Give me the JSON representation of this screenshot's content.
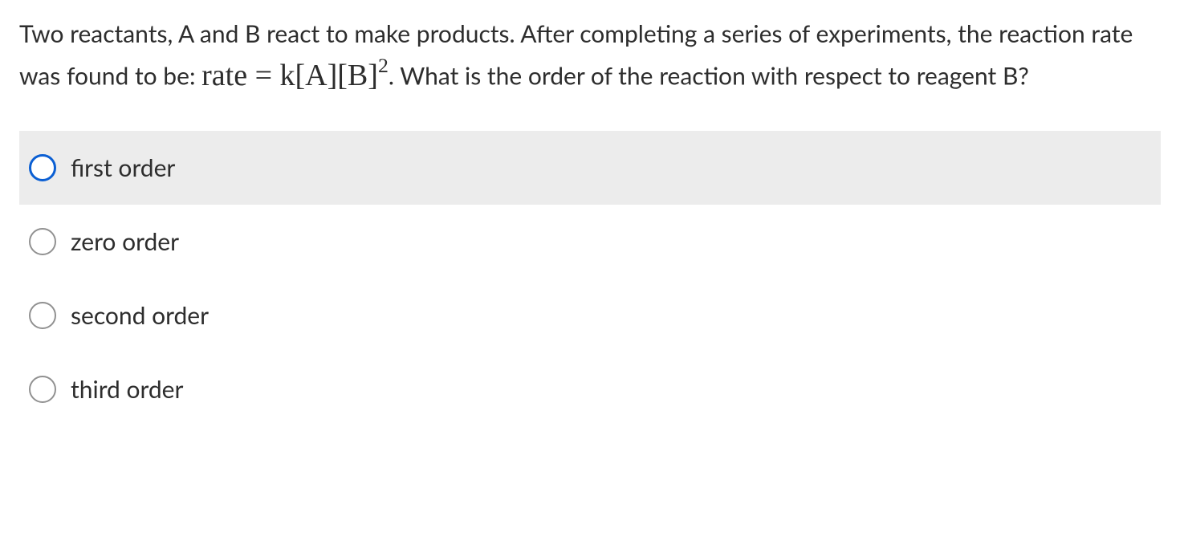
{
  "question": {
    "prefix": "Two reactants, A and B react to make products. After completing a series of experiments, the reaction rate was found to be: ",
    "formula_lhs": "rate",
    "formula_eq": " = ",
    "formula_rhs_base": "k[A][B]",
    "formula_rhs_exp": "2",
    "suffix": ". What is the order of the reaction with respect to reagent B?"
  },
  "options": [
    {
      "label": "first order",
      "hovered": true
    },
    {
      "label": "zero order",
      "hovered": false
    },
    {
      "label": "second order",
      "hovered": false
    },
    {
      "label": "third order",
      "hovered": false
    }
  ]
}
